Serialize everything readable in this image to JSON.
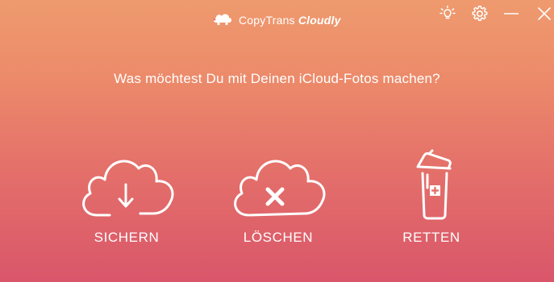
{
  "app": {
    "brand_light": "CopyTrans",
    "brand_bold": "Cloudly",
    "logo_icon": "cloud-turtle-icon",
    "accent_top": "#ef9a6e",
    "accent_bottom": "#d9566a"
  },
  "titlebar": {
    "icons": [
      "lightbulb-icon",
      "gear-icon",
      "minimize-icon",
      "close-icon"
    ]
  },
  "main": {
    "question": "Was möchtest Du mit Deinen iCloud-Fotos machen?",
    "actions": [
      {
        "label": "SICHERN",
        "icon": "cloud-download-icon"
      },
      {
        "label": "LÖSCHEN",
        "icon": "cloud-delete-icon"
      },
      {
        "label": "RETTEN",
        "icon": "trash-restore-icon"
      }
    ]
  }
}
